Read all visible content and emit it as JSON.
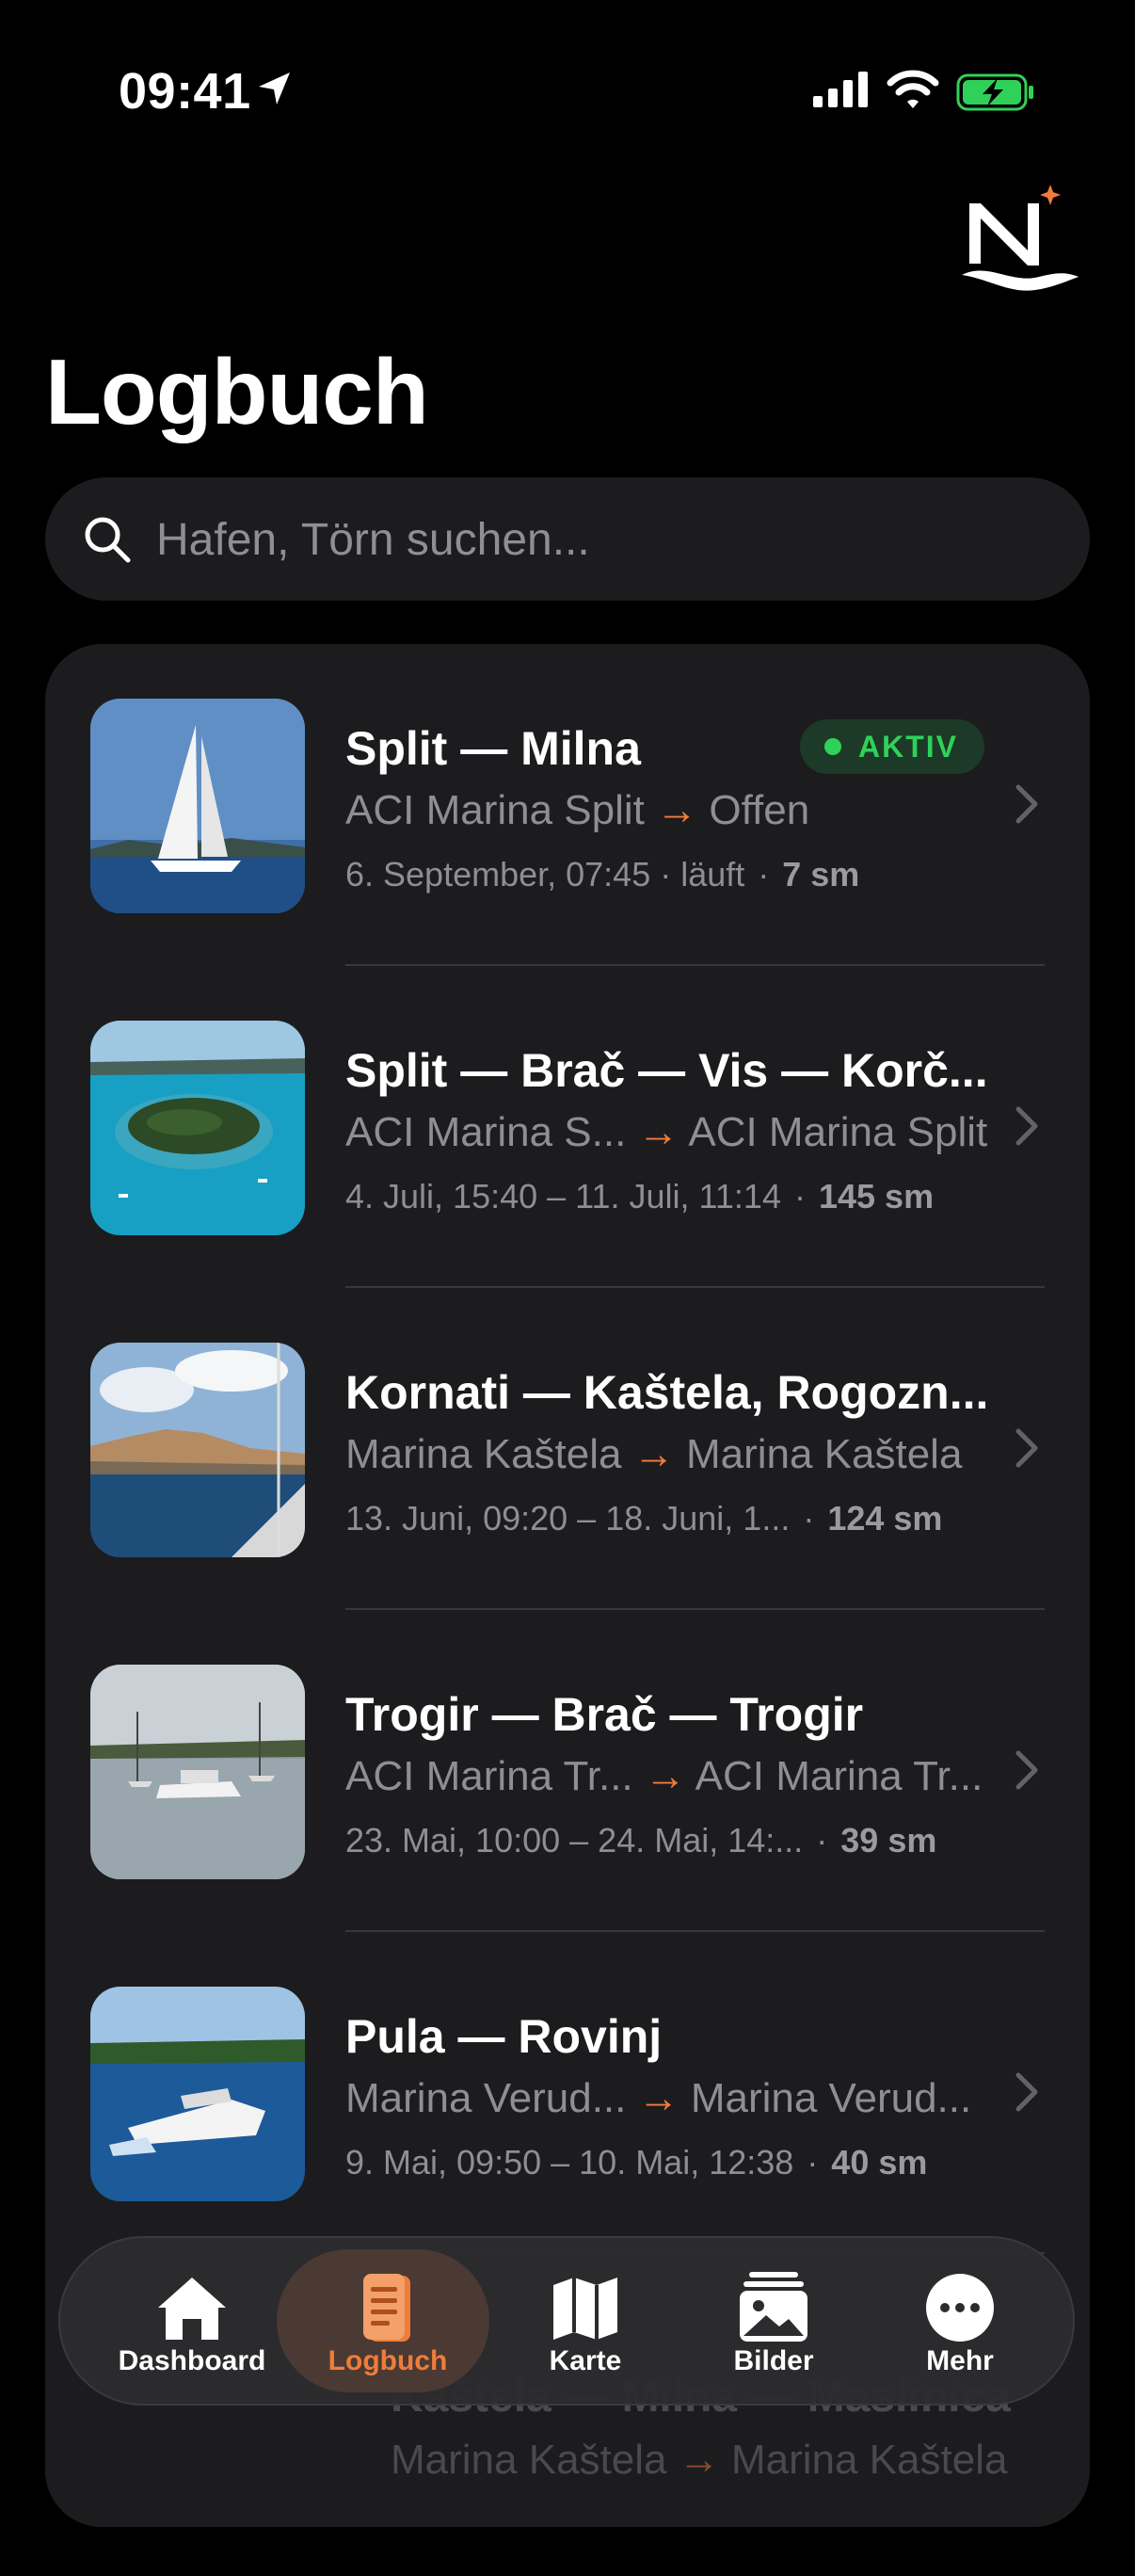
{
  "status_bar": {
    "time": "09:41"
  },
  "header": {
    "title": "Logbuch"
  },
  "search": {
    "placeholder": "Hafen, Törn suchen..."
  },
  "colors": {
    "accent": "#f07c3a",
    "active_green": "#30d158",
    "card_bg": "#1c1c1e"
  },
  "trips": [
    {
      "title": "Split — Milna",
      "from": "ACI Marina Split",
      "to": "Offen",
      "dates": "6. September, 07:45 · läuft",
      "distance": "7 sm",
      "badge": "AKTIV",
      "image": "sailboat"
    },
    {
      "title": "Split — Brač — Vis — Korč...",
      "from": "ACI Marina S...",
      "to": "ACI Marina Split",
      "dates": "4. Juli, 15:40 – 11. Juli, 11:14",
      "distance": "145 sm",
      "image": "island"
    },
    {
      "title": "Kornati — Kaštela, Rogozn...",
      "from": "Marina Kaštela",
      "to": "Marina Kaštela",
      "dates": "13. Juni, 09:20 – 18. Juni, 1...",
      "distance": "124 sm",
      "image": "harbour-town"
    },
    {
      "title": "Trogir — Brač — Trogir",
      "from": "ACI Marina Tr...",
      "to": "ACI Marina Tr...",
      "dates": "23. Mai, 10:00 – 24. Mai, 14:...",
      "distance": "39 sm",
      "image": "anchorage"
    },
    {
      "title": "Pula — Rovinj",
      "from": "Marina Verud...",
      "to": "Marina Verud...",
      "dates": "9. Mai, 09:50 – 10. Mai, 12:38",
      "distance": "40 sm",
      "image": "motorboat"
    },
    {
      "title": "Kaštela — Milna — Maslinica",
      "from": "Marina Kaštela",
      "to": "Marina Kaštela"
    }
  ],
  "tabs": [
    {
      "label": "Dashboard",
      "icon": "house-icon"
    },
    {
      "label": "Logbuch",
      "icon": "logbook-icon",
      "active": true
    },
    {
      "label": "Karte",
      "icon": "map-icon"
    },
    {
      "label": "Bilder",
      "icon": "photos-icon"
    },
    {
      "label": "Mehr",
      "icon": "more-icon"
    }
  ]
}
